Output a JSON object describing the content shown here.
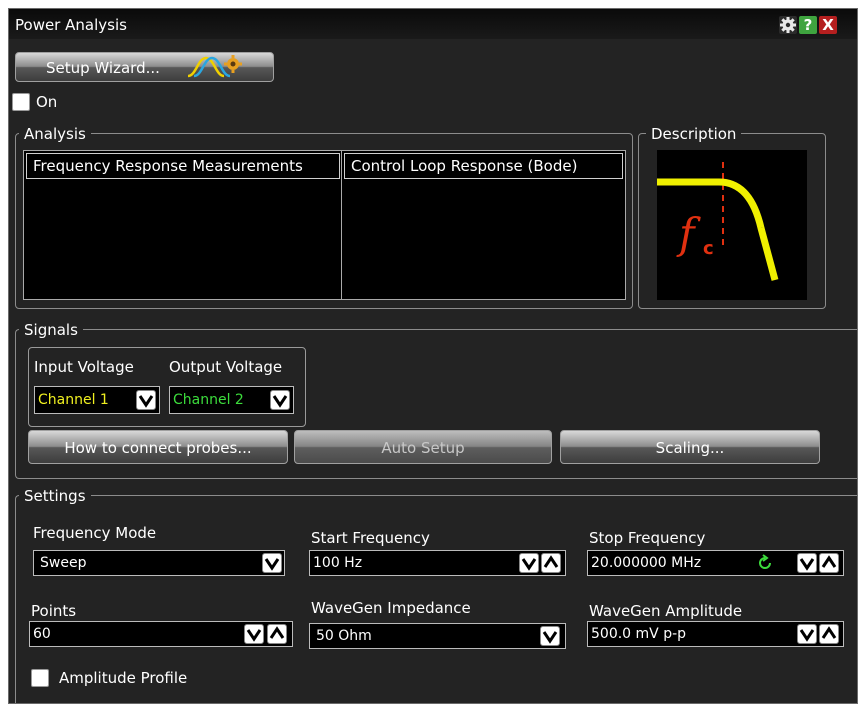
{
  "window": {
    "title": "Power Analysis"
  },
  "toolbar": {
    "setup_wizard_label": "Setup Wizard...",
    "on_label": "On",
    "on_checked": false
  },
  "analysis": {
    "legend": "Analysis",
    "items": [
      "Frequency Response Measurements",
      "Control Loop Response (Bode)"
    ]
  },
  "description": {
    "legend": "Description"
  },
  "signals": {
    "legend": "Signals",
    "input_voltage_label": "Input Voltage",
    "input_voltage_value": "Channel 1",
    "input_color": "#f0f020",
    "output_voltage_label": "Output Voltage",
    "output_voltage_value": "Channel 2",
    "output_color": "#3cdc3c",
    "probes_button": "How to connect probes...",
    "auto_setup_button": "Auto Setup",
    "scaling_button": "Scaling..."
  },
  "settings": {
    "legend": "Settings",
    "frequency_mode_label": "Frequency Mode",
    "frequency_mode_value": "Sweep",
    "start_frequency_label": "Start Frequency",
    "start_frequency_value": "100 Hz",
    "stop_frequency_label": "Stop Frequency",
    "stop_frequency_value": "20.000000 MHz",
    "points_label": "Points",
    "points_value": "60",
    "wavegen_impedance_label": "WaveGen Impedance",
    "wavegen_impedance_value": "50 Ohm",
    "wavegen_amplitude_label": "WaveGen Amplitude",
    "wavegen_amplitude_value": "500.0 mV p-p",
    "amplitude_profile_label": "Amplitude Profile",
    "amplitude_profile_checked": false
  },
  "colors": {
    "close": "#b51f1f",
    "help": "#3fa43f",
    "graph_curve": "#f0f000",
    "cutoff_marker": "#e03010"
  },
  "icons": {
    "settings": "gear-icon",
    "help": "help-icon",
    "close": "close-icon",
    "wizard": "wizard-wave-gear-icon",
    "chevron_down": "chevron-down-icon",
    "chevron_up": "chevron-up-icon",
    "refresh": "refresh-icon"
  }
}
